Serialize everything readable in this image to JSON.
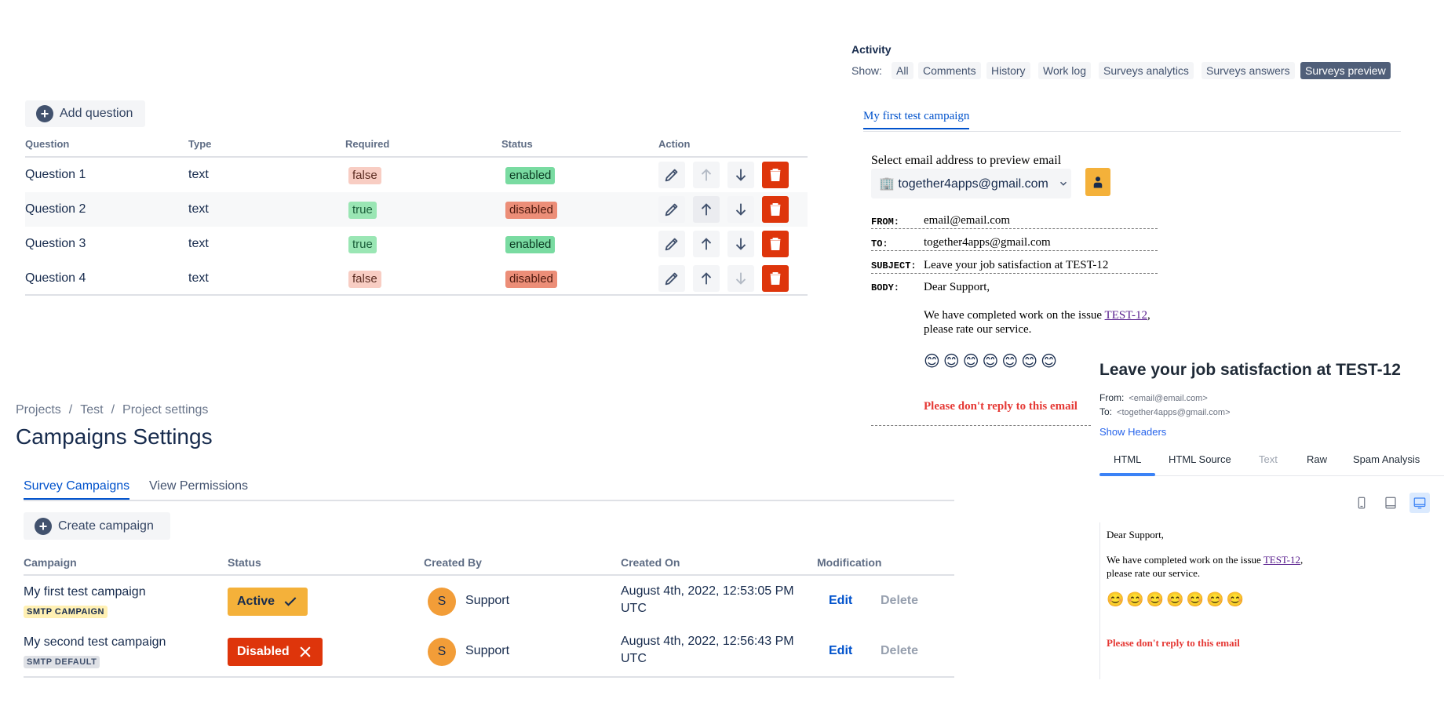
{
  "questions": {
    "add_label": "Add question",
    "headers": {
      "question": "Question",
      "type": "Type",
      "required": "Required",
      "status": "Status",
      "action": "Action"
    },
    "rows": [
      {
        "question": "Question 1",
        "type": "text",
        "required": "false",
        "status": "enabled"
      },
      {
        "question": "Question 2",
        "type": "text",
        "required": "true",
        "status": "disabled"
      },
      {
        "question": "Question 3",
        "type": "text",
        "required": "true",
        "status": "enabled"
      },
      {
        "question": "Question 4",
        "type": "text",
        "required": "false",
        "status": "disabled"
      }
    ],
    "icons": {
      "edit": "pencil-icon",
      "up": "arrow-up-icon",
      "down": "arrow-down-icon",
      "delete": "trash-icon"
    }
  },
  "activity": {
    "title": "Activity",
    "show_label": "Show:",
    "filters": [
      "All",
      "Comments",
      "History",
      "Work log",
      "Surveys analytics",
      "Surveys answers",
      "Surveys preview"
    ],
    "selected_filter": "Surveys preview",
    "campaign_tab": "My first test campaign",
    "select_label": "Select email address to preview email",
    "select_value": "🏢 together4apps@gmail.com",
    "email": {
      "from_label": "FROM:",
      "from_value": "email@email.com",
      "to_label": "TO:",
      "to_value": "together4apps@gmail.com",
      "subject_label": "SUBJECT:",
      "subject_value": "Leave your job satisfaction at TEST-12",
      "body_label": "BODY:",
      "greeting": "Dear Support,",
      "line1_pre": "We have completed work on the issue ",
      "issue_link": "TEST-12",
      "line1_post": ",",
      "line2": "please rate our service.",
      "smileys": "😊😊😊😊😊😊😊",
      "no_reply": "Please don't reply to this email"
    }
  },
  "mail_preview": {
    "title": "Leave your job satisfaction at TEST-12",
    "from_label": "From:",
    "from_value": "<email@email.com>",
    "to_label": "To:",
    "to_value": "<together4apps@gmail.com>",
    "show_headers": "Show Headers",
    "tabs": [
      "HTML",
      "HTML Source",
      "Text",
      "Raw",
      "Spam Analysis"
    ],
    "selected_tab": "HTML",
    "body": {
      "greeting": "Dear Support,",
      "line1_pre": "We have completed work on the issue ",
      "issue_link": "TEST-12",
      "line1_post": ",",
      "line2": "please rate our service.",
      "smileys": "😊😊😊😊😊😊😊",
      "no_reply": "Please don't reply to this email"
    }
  },
  "campaigns": {
    "breadcrumbs": [
      "Projects",
      "Test",
      "Project settings"
    ],
    "page_title": "Campaigns Settings",
    "tabs": [
      "Survey Campaigns",
      "View Permissions"
    ],
    "create_label": "Create campaign",
    "headers": {
      "campaign": "Campaign",
      "status": "Status",
      "created_by": "Created By",
      "created_on": "Created On",
      "modification": "Modification"
    },
    "rows": [
      {
        "name": "My first test campaign",
        "tag": "SMTP CAMPAIGN",
        "status": "Active",
        "avatar": "S",
        "created_by": "Support",
        "created_on_1": "August 4th, 2022, 12:53:05 PM",
        "created_on_2": "UTC",
        "edit": "Edit",
        "delete": "Delete"
      },
      {
        "name": "My second test campaign",
        "tag": "SMTP DEFAULT",
        "status": "Disabled",
        "avatar": "S",
        "created_by": "Support",
        "created_on_1": "August 4th, 2022, 12:56:43 PM",
        "created_on_2": "UTC",
        "edit": "Edit",
        "delete": "Delete"
      }
    ]
  },
  "colors": {
    "accent": "#0052cc",
    "danger": "#de350b",
    "warning": "#f4b13a"
  }
}
